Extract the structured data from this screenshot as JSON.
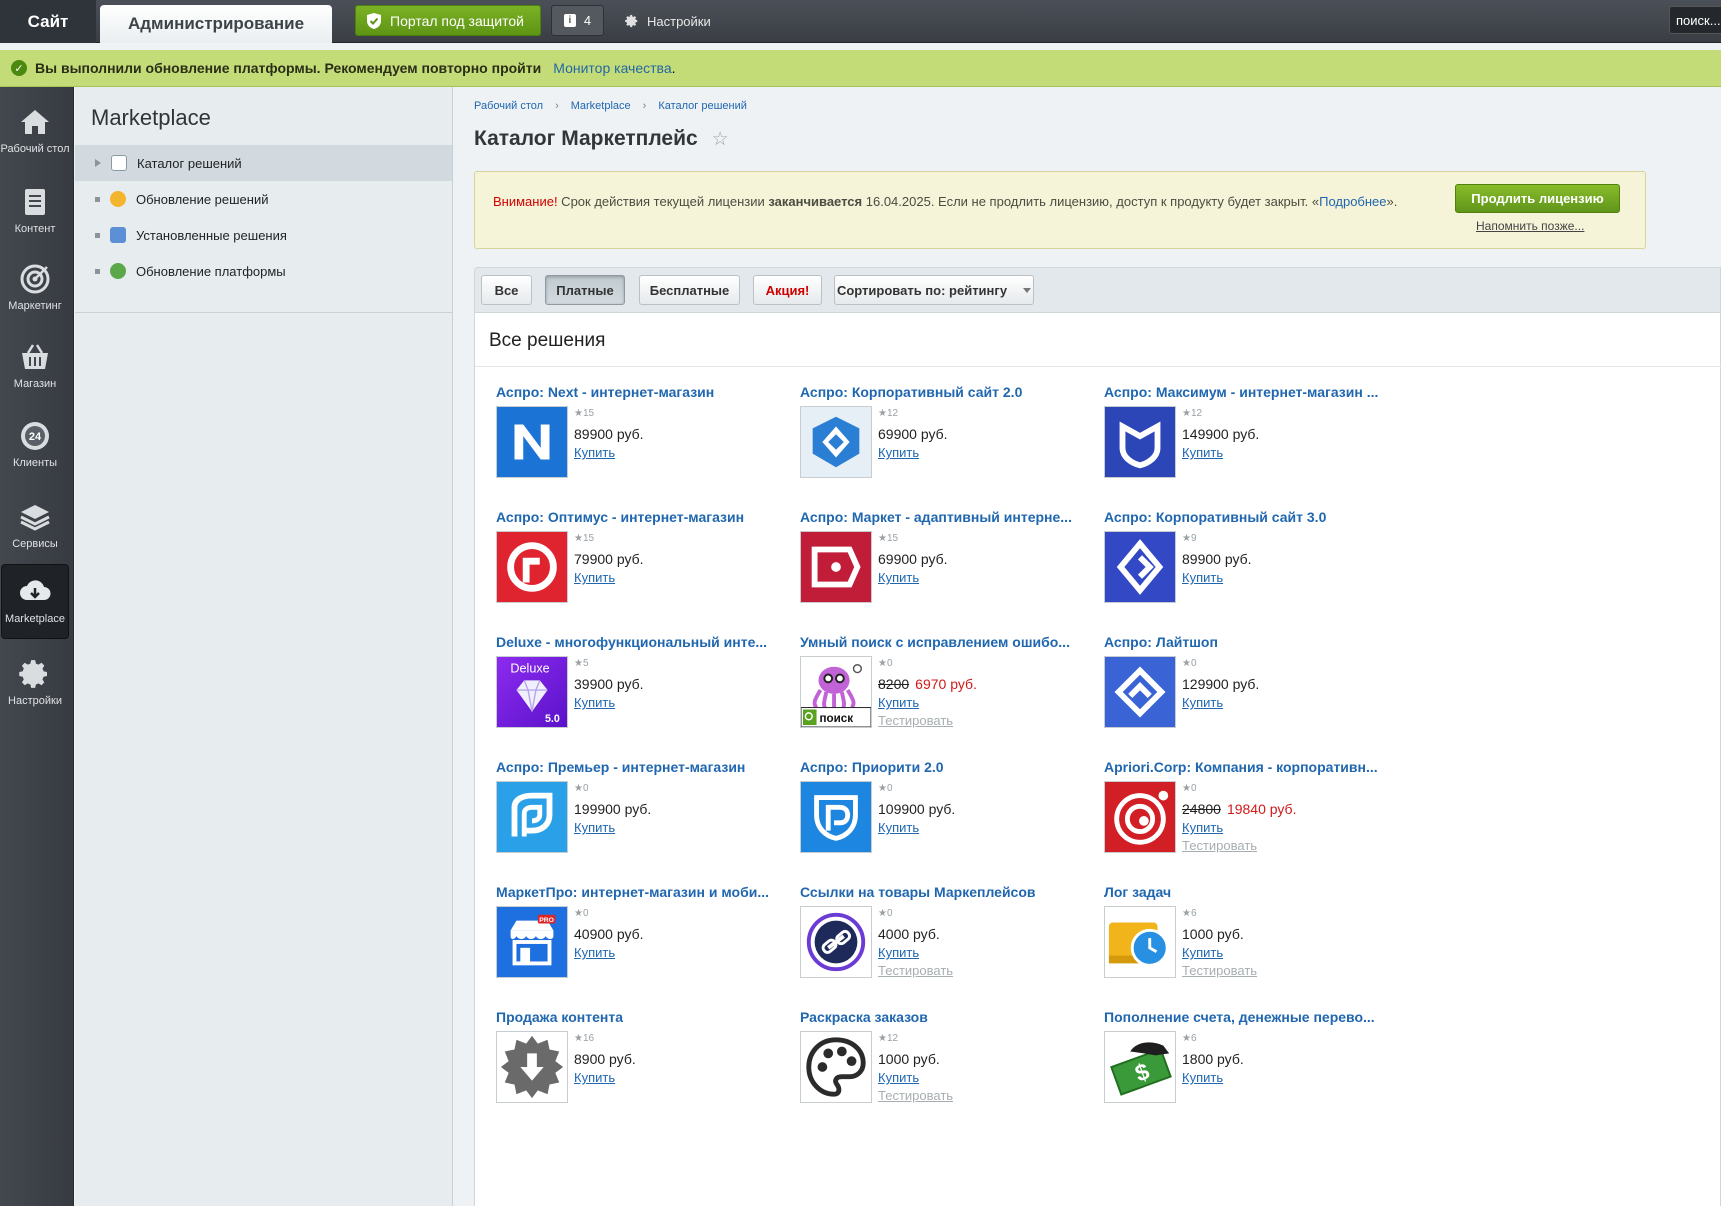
{
  "topbar": {
    "site_tab": "Сайт",
    "admin_tab": "Администрирование",
    "secure_label": "Портал под защитой",
    "notif_count": "4",
    "settings_label": "Настройки",
    "search_placeholder": "поиск..."
  },
  "banner": {
    "message": "Вы выполнили обновление платформы. Рекомендуем повторно пройти",
    "link": "Монитор качества",
    "tail": "."
  },
  "leftmenu": [
    {
      "label": "Рабочий стол",
      "icon": "home-icon"
    },
    {
      "label": "Контент",
      "icon": "document-icon"
    },
    {
      "label": "Маркетинг",
      "icon": "target-icon"
    },
    {
      "label": "Магазин",
      "icon": "basket-icon"
    },
    {
      "label": "Клиенты",
      "icon": "clients-24-icon"
    },
    {
      "label": "Сервисы",
      "icon": "layers-icon"
    },
    {
      "label": "Marketplace",
      "icon": "cloud-download-icon"
    },
    {
      "label": "Настройки",
      "icon": "gear-icon"
    }
  ],
  "submenu": {
    "title": "Marketplace",
    "items": [
      {
        "label": "Каталог решений"
      },
      {
        "label": "Обновление решений"
      },
      {
        "label": "Установленные решения"
      },
      {
        "label": "Обновление платформы"
      }
    ]
  },
  "breadcrumbs": [
    "Рабочий стол",
    "Marketplace",
    "Каталог решений"
  ],
  "page_title": "Каталог Маркетплейс",
  "license": {
    "warn": "Внимание!",
    "text1": " Срок действия текущей лицензии ",
    "bold": "заканчивается",
    "text2": " 16.04.2025. Если не продлить лицензию, доступ к продукту будет закрыт. «",
    "more": "Подробнее",
    "text3": "».",
    "renew_button": "Продлить лицензию",
    "remind_later": "Напомнить позже..."
  },
  "filters": {
    "all": "Все",
    "paid": "Платные",
    "free": "Бесплатные",
    "promo": "Акция!",
    "sort": "Сортировать по: рейтингу"
  },
  "panel_title": "Все решения",
  "buy_label": "Купить",
  "test_label": "Тестировать",
  "products": [
    {
      "title": "Аспро: Next - интернет-магазин",
      "rating": "★15",
      "price": "89900 руб.",
      "icon": "aspro-next-icon"
    },
    {
      "title": "Аспро: Корпоративный сайт 2.0",
      "rating": "★12",
      "price": "69900 руб.",
      "icon": "aspro-corp2-icon"
    },
    {
      "title": "Аспро: Максимум - интернет-магазин ...",
      "rating": "★12",
      "price": "149900 руб.",
      "icon": "aspro-max-icon"
    },
    {
      "title": "Аспро: Оптимус - интернет-магазин",
      "rating": "★15",
      "price": "79900 руб.",
      "icon": "aspro-optimus-icon"
    },
    {
      "title": "Аспро: Маркет - адаптивный интерне...",
      "rating": "★15",
      "price": "69900 руб.",
      "icon": "aspro-market-icon"
    },
    {
      "title": "Аспро: Корпоративный сайт 3.0",
      "rating": "★9",
      "price": "89900 руб.",
      "icon": "aspro-corp3-icon"
    },
    {
      "title": "Deluxe - многофункциональный инте...",
      "rating": "★5",
      "price": "39900 руб.",
      "icon": "deluxe-diamond-icon",
      "badge": "Deluxe",
      "version": "5.0"
    },
    {
      "title": "Умный поиск с исправлением ошибо...",
      "rating": "★0",
      "price_old": "8200",
      "price_new": "6970 руб.",
      "icon": "octopus-search-icon",
      "search_word": "поиск",
      "test": true
    },
    {
      "title": "Аспро: Лайтшоп",
      "rating": "★0",
      "price": "129900 руб.",
      "icon": "aspro-lightshop-icon"
    },
    {
      "title": "Аспро: Премьер - интернет-магазин",
      "rating": "★0",
      "price": "199900 руб.",
      "icon": "aspro-premier-icon"
    },
    {
      "title": "Аспро: Приорити 2.0",
      "rating": "★0",
      "price": "109900 руб.",
      "icon": "aspro-priority-icon"
    },
    {
      "title": "Apriori.Corp: Компания - корпоративн...",
      "rating": "★0",
      "price_old": "24800",
      "price_new": "19840 руб.",
      "icon": "apriori-icon",
      "test": true
    },
    {
      "title": "МаркетПро: интернет-магазин и моби...",
      "rating": "★0",
      "price": "40900 руб.",
      "icon": "marketpro-shop-icon",
      "badge": "PRO"
    },
    {
      "title": "Ссылки на товары Маркеплейсов",
      "rating": "★0",
      "price": "4000 руб.",
      "icon": "link-chain-icon",
      "test": true
    },
    {
      "title": "Лог задач",
      "rating": "★6",
      "price": "1000 руб.",
      "icon": "task-log-clock-icon",
      "test": true
    },
    {
      "title": "Продажа контента",
      "rating": "★16",
      "price": "8900 руб.",
      "icon": "download-badge-icon"
    },
    {
      "title": "Раскраска заказов",
      "rating": "★12",
      "price": "1000 руб.",
      "icon": "palette-icon",
      "test": true
    },
    {
      "title": "Пополнение счета, денежные перево...",
      "rating": "★6",
      "price": "1800 руб.",
      "icon": "money-hand-icon"
    }
  ]
}
